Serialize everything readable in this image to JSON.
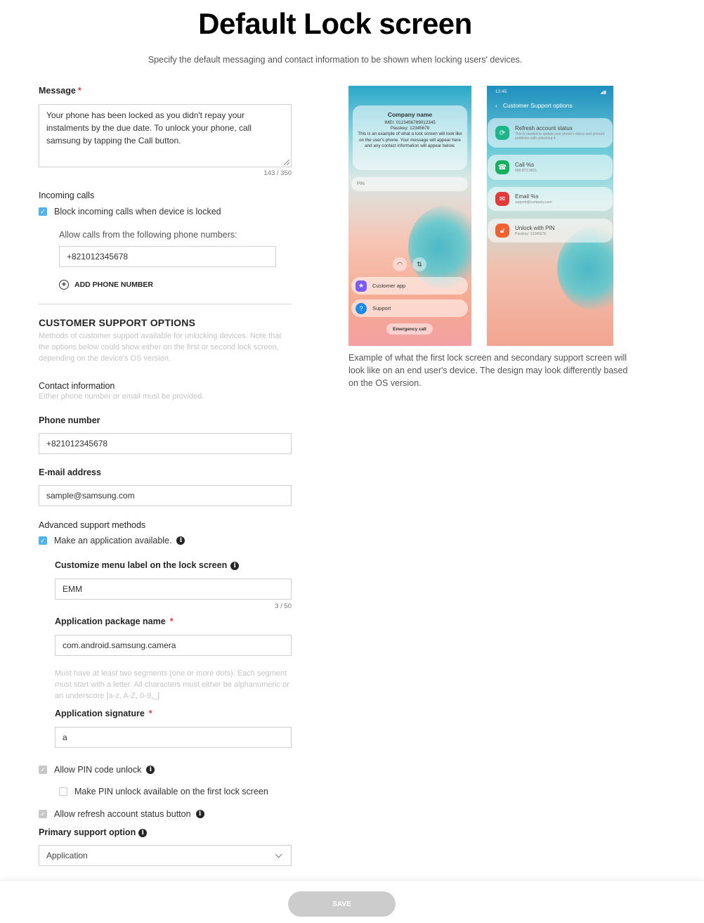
{
  "header": {
    "title": "Default Lock screen",
    "subtitle": "Specify the default messaging and contact information to be shown when locking users' devices."
  },
  "message": {
    "label": "Message",
    "required_mark": "*",
    "value": "Your phone has been locked as you didn't repay your instalments by the due date. To unlock your phone, call samsung by tapping the Call button.",
    "counter": "143 / 350"
  },
  "incoming_calls": {
    "label": "Incoming calls",
    "block_checkbox": {
      "label": "Block incoming calls when device is locked",
      "checked": true
    },
    "allow_label": "Allow calls from the following phone numbers:",
    "phone_value": "+821012345678",
    "add_button": "ADD PHONE NUMBER"
  },
  "support": {
    "title": "CUSTOMER SUPPORT OPTIONS",
    "description": "Methods of customer support available for unlocking devices. Note that the options below could show either on the first or second lock screen, depending on the device's OS version.",
    "contact_title": "Contact information",
    "contact_hint": "Either phone number or email must be provided.",
    "phone_label": "Phone number",
    "phone_value": "+821012345678",
    "email_label": "E-mail address",
    "email_value": "sample@samsung.com",
    "advanced_title": "Advanced support methods",
    "make_app": {
      "label": "Make an application available.",
      "checked": true
    },
    "menu_label_title": "Customize menu label on the lock screen",
    "menu_label_value": "EMM",
    "menu_label_counter": "3 / 50",
    "package_label": "Application package name",
    "package_value": "com.android.samsung.camera",
    "package_hint": "Must have at least two segments (one or more dots). Each segment must start with a letter. All characters must either be alphanumeric or an underscore [a-z, A-Z, 0-9,_]",
    "signature_label": "Application signature",
    "signature_value": "a",
    "pin_unlock": {
      "label": "Allow PIN code unlock",
      "checked": true,
      "disabled": true
    },
    "pin_first": {
      "label": "Make PIN unlock available on the first lock screen",
      "checked": false
    },
    "refresh": {
      "label": "Allow refresh account status button",
      "checked": true,
      "disabled": true
    },
    "primary_label": "Primary support option",
    "primary_value": "Application"
  },
  "preview": {
    "phone1": {
      "company": "Company name",
      "message": "IMEI: 0123456789012345\nPasskey: 12345678\nThis is an example of what a lock screen will look like on the user's phone. Your message will appear here and any contact information will appear below.",
      "pin_placeholder": "PIN",
      "options": [
        "Customer app",
        "Support"
      ],
      "emergency": "Emergency call"
    },
    "phone2": {
      "time": "12:45",
      "header": "Customer Support options",
      "cards": [
        {
          "title": "Refresh account status",
          "sub": "This is needed to update your phone's status and prevent problems with unlocking it."
        },
        {
          "title": "Call %s",
          "sub": "098-872-9821"
        },
        {
          "title": "Email %s",
          "sub": "support@company.com"
        },
        {
          "title": "Unlock with PIN",
          "sub": "Passkey: 12345678"
        }
      ]
    },
    "caption": "Example of what the first lock screen and secondary support screen will look like on an end user's device. The design may look differently based on the OS version."
  },
  "footer": {
    "save_label": "SAVE"
  },
  "colors": {
    "accent": "#4fb3f0",
    "required": "#e53935",
    "disabled_button": "#cccccc"
  }
}
